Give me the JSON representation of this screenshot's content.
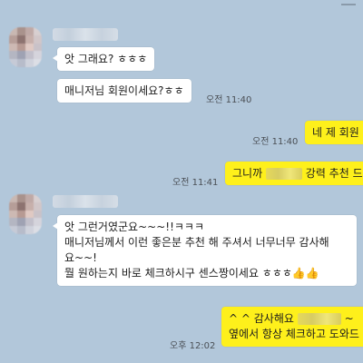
{
  "messages": {
    "m1": {
      "text": "앗 그래요? ㅎㅎㅎ"
    },
    "m2": {
      "text": "매니저님 회원이세요?ㅎㅎ",
      "time": "오전 11:40"
    },
    "m3": {
      "text": "네 제 회원",
      "time": "오전 11:40"
    },
    "m4": {
      "prefix": "그니까",
      "suffix": "강력 추천 드",
      "time": "오전 11:41"
    },
    "m5": {
      "line1": "앗 그런거였군요~~~!!ㅋㅋㅋ",
      "line2": "매니저님께서 이런 좋은분 추천 해 주셔서 너무너무 감사해",
      "line3": "요~~!",
      "line4": "뭘 원하는지 바로 체크하시구 센스짱이세요 ㅎㅎㅎ👍👍"
    },
    "m6": {
      "line1_prefix": "^ ^ 감사해요",
      "line1_suffix": "~",
      "line2": "옆에서 항상 체크하고 도와드",
      "time": "오후 12:02"
    }
  },
  "colors": {
    "background": "#b2c7da",
    "incoming_bubble": "#ffffff",
    "outgoing_bubble": "#fef01b"
  }
}
